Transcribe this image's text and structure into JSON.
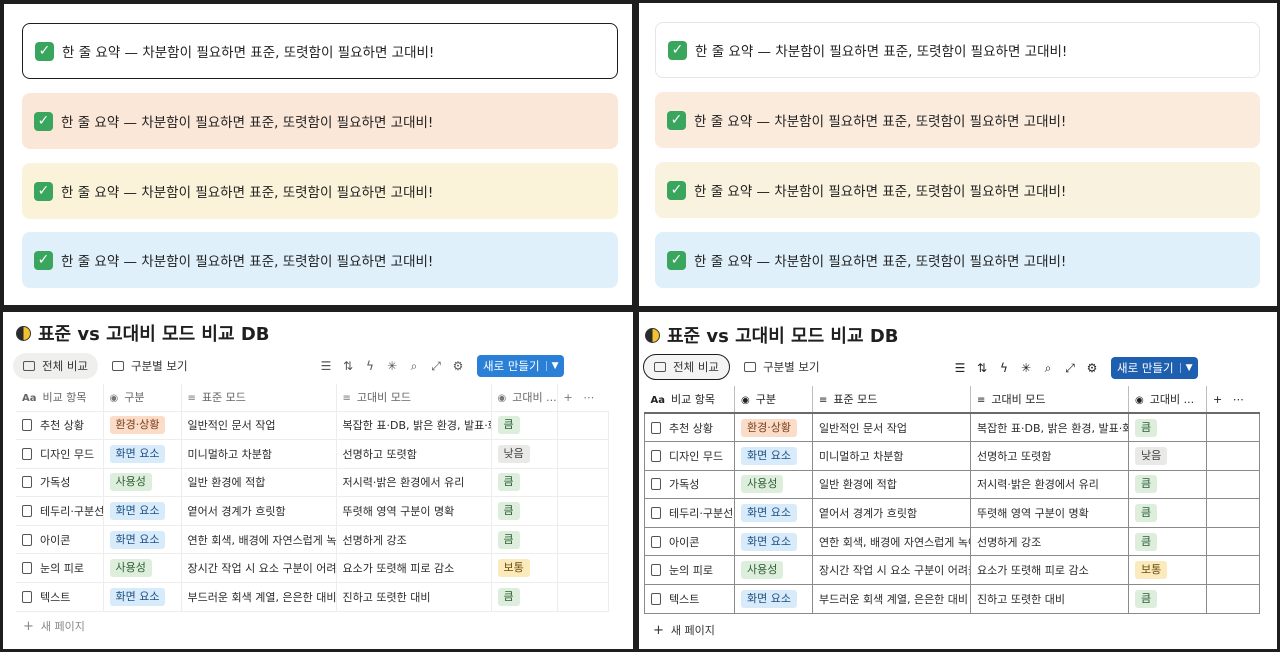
{
  "callout": {
    "icon": "check-mark-icon",
    "text": "한 줄 요약 — 차분함이 필요하면 표준, 또렷함이 필요하면 고대비!"
  },
  "db": {
    "title": "표준 vs 고대비 모드 비교 DB",
    "tabs": {
      "all": "전체 비교",
      "grouped": "구분별 보기"
    },
    "new_button": "새로 만들기",
    "columns": {
      "item": "비교 항목",
      "category": "구분",
      "standard": "표준 모드",
      "high_contrast": "고대비 모드",
      "high_contrast_short": "고대비 ..."
    },
    "rows": [
      {
        "item": "추천 상황",
        "category": "환경·상황",
        "cat_color": "orange",
        "standard": "일반적인 문서 작업",
        "high": "복잡한 표·DB, 밝은 환경, 발표·화면",
        "rating": "큼",
        "rating_color": "green"
      },
      {
        "item": "디자인 무드",
        "category": "화면 요소",
        "cat_color": "blue",
        "standard": "미니멀하고 차분함",
        "high": "선명하고 또렷함",
        "rating": "낮음",
        "rating_color": "gray"
      },
      {
        "item": "가독성",
        "category": "사용성",
        "cat_color": "green",
        "standard": "일반 환경에 적합",
        "high": "저시력·밝은 환경에서 유리",
        "rating": "큼",
        "rating_color": "green"
      },
      {
        "item": "테두리·구분선",
        "category": "화면 요소",
        "cat_color": "blue",
        "standard": "옅어서 경계가 흐릿함",
        "high": "뚜렷해 영역 구분이 명확",
        "rating": "큼",
        "rating_color": "green"
      },
      {
        "item": "아이콘",
        "category": "화면 요소",
        "cat_color": "blue",
        "standard": "연한 회색, 배경에 자연스럽게 녹아",
        "high": "선명하게 강조",
        "rating": "큼",
        "rating_color": "green"
      },
      {
        "item": "눈의 피로",
        "category": "사용성",
        "cat_color": "green",
        "standard": "장시간 작업 시 요소 구분이 어려울",
        "high": "요소가 또렷해 피로 감소",
        "rating": "보통",
        "rating_color": "yellow"
      },
      {
        "item": "텍스트",
        "category": "화면 요소",
        "cat_color": "blue",
        "standard": "부드러운 회색 계열, 은은한 대비",
        "high": "진하고 또렷한 대비",
        "rating": "큼",
        "rating_color": "green"
      }
    ],
    "new_page": "새 페이지"
  }
}
